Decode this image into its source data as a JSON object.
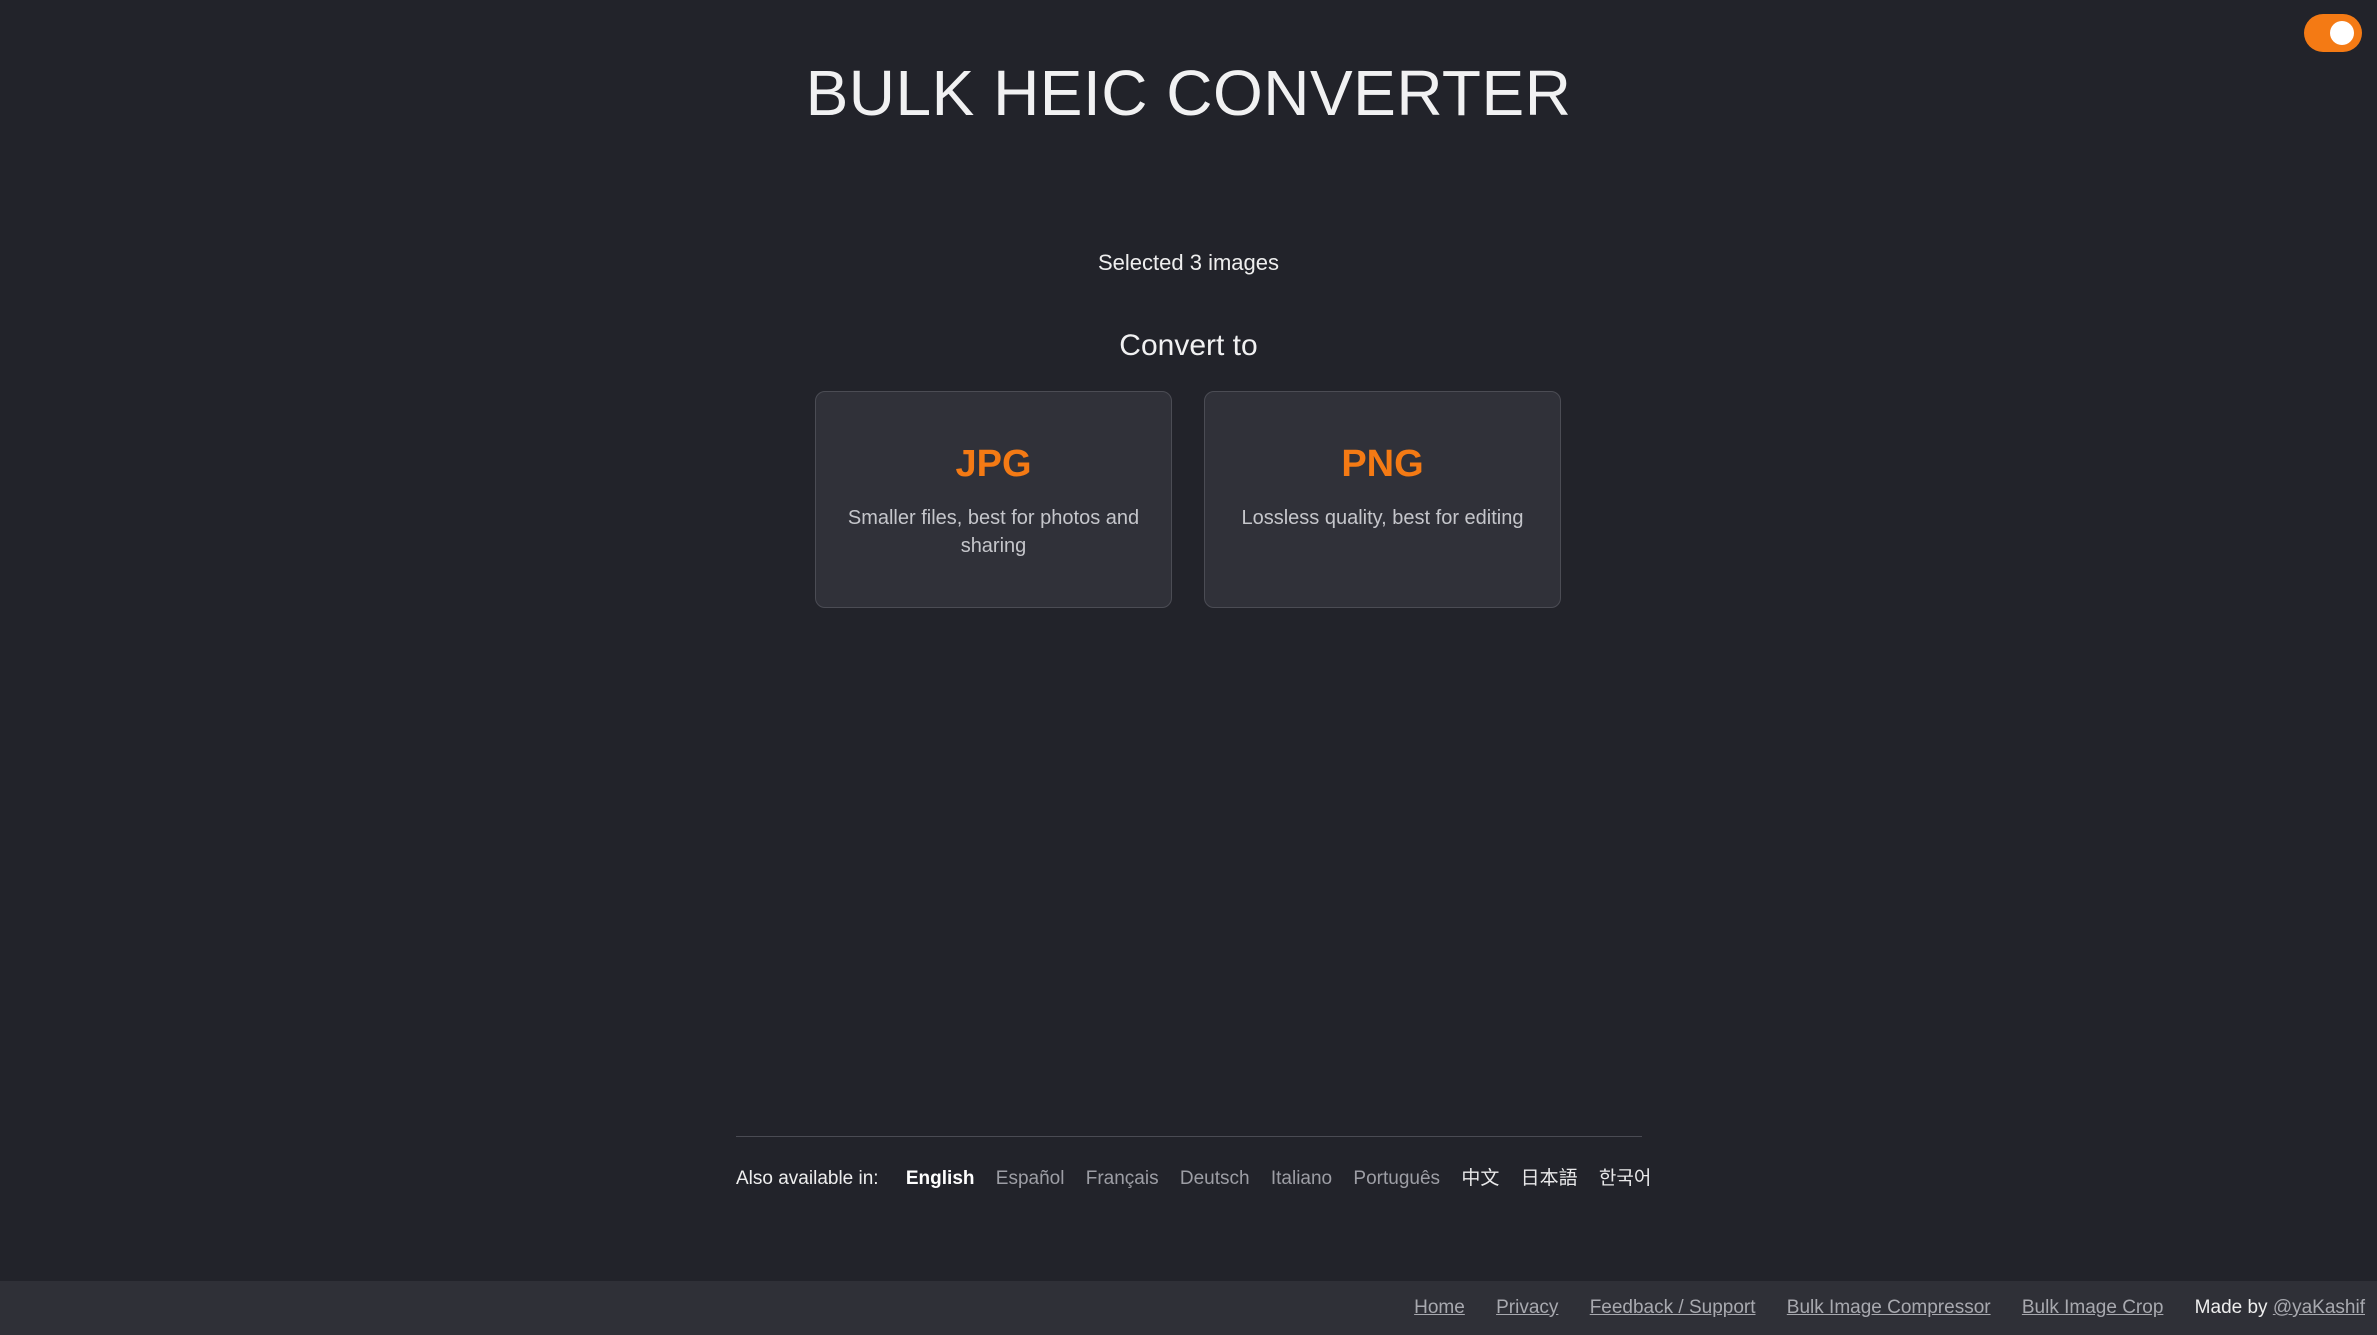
{
  "header": {
    "title": "BULK HEIC CONVERTER"
  },
  "theme_toggle": {
    "state": "on",
    "accent": "#f47a14"
  },
  "main": {
    "selected_text": "Selected 3 images",
    "convert_label": "Convert to",
    "options": [
      {
        "format": "JPG",
        "description": "Smaller files, best for photos and sharing"
      },
      {
        "format": "PNG",
        "description": "Lossless quality, best for editing"
      }
    ]
  },
  "languages": {
    "lead": "Also available in:",
    "items": [
      "English",
      "Español",
      "Français",
      "Deutsch",
      "Italiano",
      "Português",
      "中文",
      "日本語",
      "한국어"
    ],
    "active": "English"
  },
  "footer": {
    "links": [
      "Home",
      "Privacy",
      "Feedback / Support",
      "Bulk Image Compressor",
      "Bulk Image Crop"
    ],
    "made_by_label": "Made by ",
    "made_by_handle": "@yaKashif"
  },
  "colors": {
    "background": "#22232a",
    "card": "#303139",
    "accent": "#f47a14",
    "footer": "#2f3037"
  }
}
